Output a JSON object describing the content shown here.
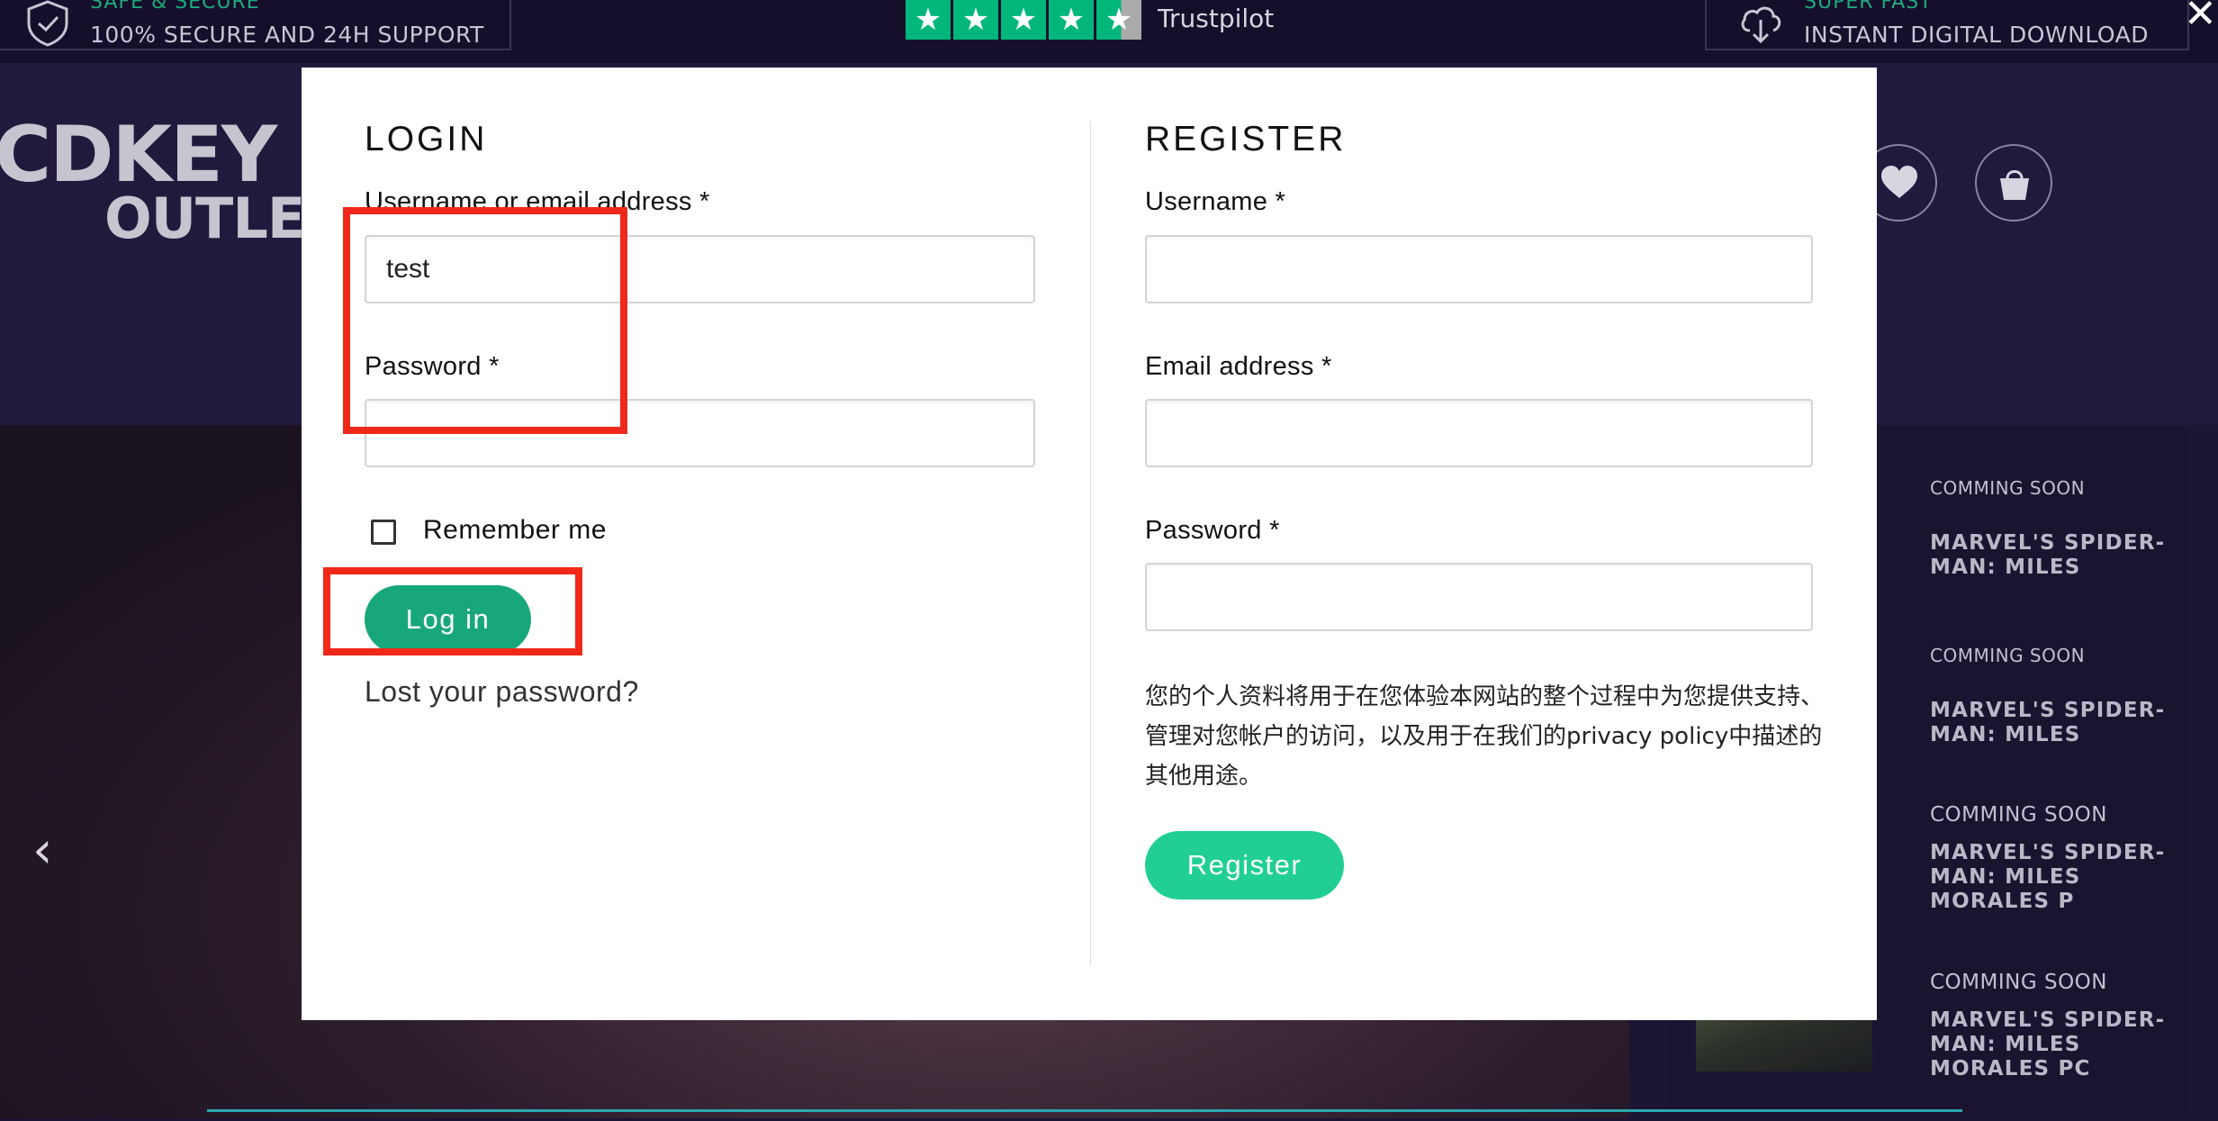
{
  "topbar": {
    "secure_title": "SAFE & SECURE",
    "secure_sub": "100% SECURE AND 24H SUPPORT",
    "trustpilot_label": "Trustpilot",
    "trustpilot_stars": "4.5 of 5",
    "download_title": "SUPER FAST",
    "download_sub": "INSTANT DIGITAL DOWNLOAD"
  },
  "logo": {
    "line1": "CDKEY",
    "line2": "OUTLET"
  },
  "header_icons": [
    "heart-icon",
    "shopping-bag-icon"
  ],
  "close_label": "✕",
  "hero_prev": "‹",
  "sidebar": {
    "items": [
      {
        "tag": "COMMING SOON",
        "title": "MARVEL'S SPIDER-MAN: MILES"
      },
      {
        "tag": "COMMING SOON",
        "title": "MARVEL'S SPIDER-MAN: MILES"
      },
      {
        "tag": "COMMING SOON",
        "title": "MARVEL'S SPIDER-MAN: MILES MORALES P"
      },
      {
        "tag": "COMMING SOON",
        "title": "MARVEL'S SPIDER-MAN: MILES MORALES PC"
      }
    ]
  },
  "login": {
    "title": "LOGIN",
    "username_label": "Username or email address *",
    "username_value": "test",
    "password_label": "Password *",
    "password_value": "············",
    "remember_label": "Remember me",
    "submit_label": "Log in",
    "lost_password": "Lost your password?"
  },
  "register": {
    "title": "REGISTER",
    "username_label": "Username *",
    "email_label": "Email address *",
    "password_label": "Password *",
    "privacy_text": "您的个人资料将用于在您体验本网站的整个过程中为您提供支持、管理对您帐户的访问，以及用于在我们的privacy policy中描述的其他用途。",
    "submit_label": "Register"
  },
  "colors": {
    "accent_green": "#18a77b",
    "register_green": "#21cf95",
    "annotation_red": "#f0281a",
    "page_bg": "#1c1533"
  }
}
